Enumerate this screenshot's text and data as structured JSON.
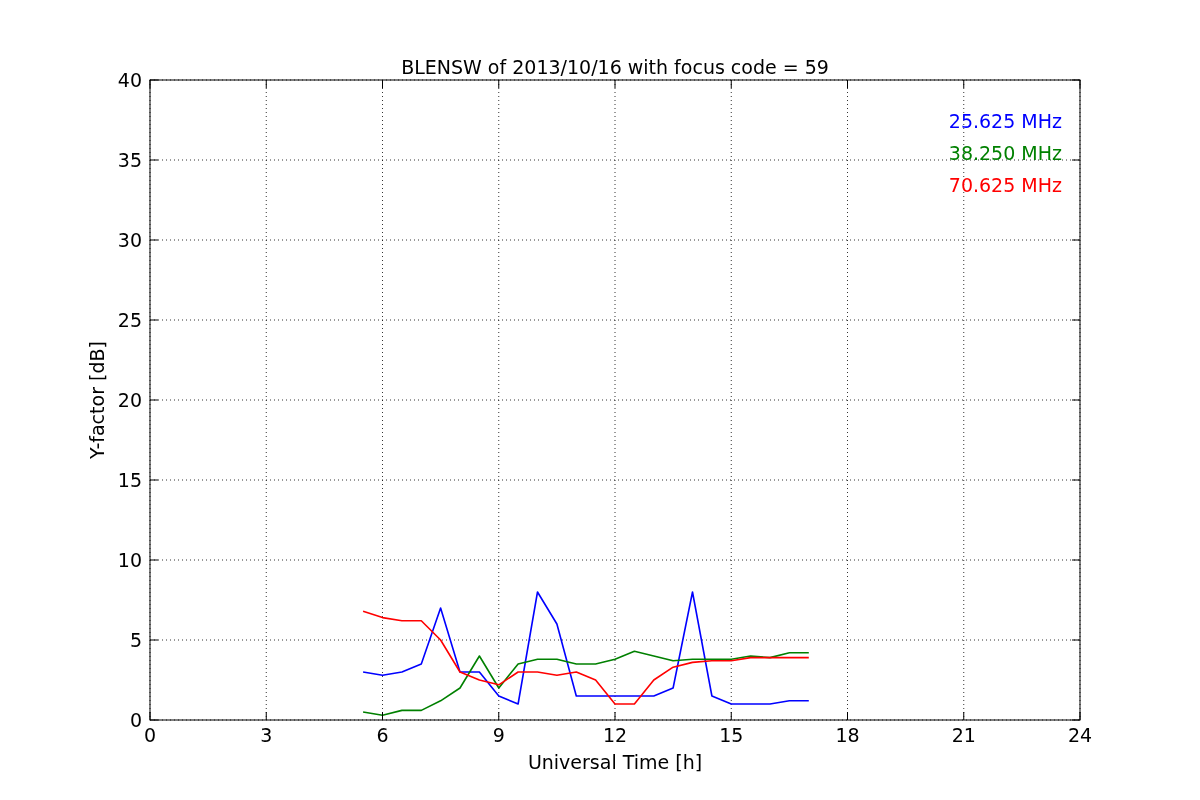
{
  "chart_data": {
    "type": "line",
    "title": "BLENSW of 2013/10/16 with focus code = 59",
    "xlabel": "Universal Time [h]",
    "ylabel": "Y-factor [dB]",
    "x": [
      5.5,
      6,
      6.5,
      7,
      7.5,
      8,
      8.5,
      9,
      9.5,
      10,
      10.5,
      11,
      11.5,
      12,
      12.5,
      13,
      13.5,
      14,
      14.5,
      15,
      15.5,
      16,
      16.5,
      17
    ],
    "series": [
      {
        "name": "25.625 MHz",
        "color": "#0000ff",
        "values": [
          3,
          2.8,
          3,
          3.5,
          7,
          3,
          3,
          1.5,
          1,
          8,
          6,
          1.5,
          1.5,
          1.5,
          1.5,
          1.5,
          2,
          8,
          1.5,
          1,
          1,
          1,
          1.2,
          1.2
        ]
      },
      {
        "name": "38.250 MHz",
        "color": "#008000",
        "values": [
          0.5,
          0.3,
          0.6,
          0.6,
          1.2,
          2,
          4,
          2,
          3.5,
          3.8,
          3.8,
          3.5,
          3.5,
          3.8,
          4.3,
          4,
          3.7,
          3.8,
          3.8,
          3.8,
          4,
          3.9,
          4.2,
          4.2
        ]
      },
      {
        "name": "70.625 MHz",
        "color": "#ff0000",
        "values": [
          6.8,
          6.4,
          6.2,
          6.2,
          5,
          3,
          2.5,
          2.2,
          3,
          3,
          2.8,
          3,
          2.5,
          1,
          1,
          2.5,
          3.3,
          3.6,
          3.7,
          3.7,
          3.9,
          3.9,
          3.9,
          3.9
        ]
      }
    ],
    "xlim": [
      0,
      24
    ],
    "ylim": [
      0,
      40
    ],
    "xticks": [
      0,
      3,
      6,
      9,
      12,
      15,
      18,
      21,
      24
    ],
    "yticks": [
      0,
      5,
      10,
      15,
      20,
      25,
      30,
      35,
      40
    ],
    "grid": true
  }
}
